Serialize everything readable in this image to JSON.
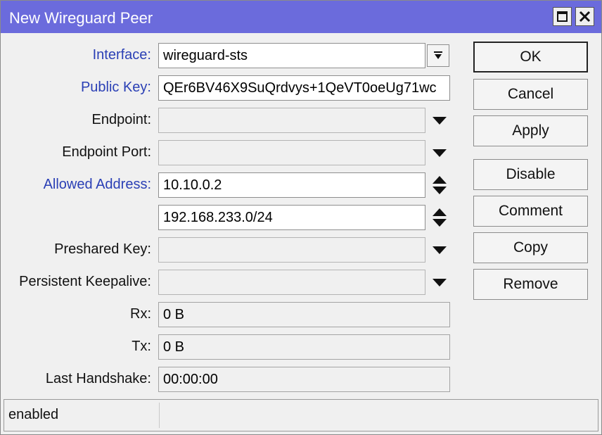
{
  "window": {
    "title": "New Wireguard Peer"
  },
  "form": {
    "interface": {
      "label": "Interface:",
      "value": "wireguard-sts"
    },
    "public_key": {
      "label": "Public Key:",
      "value": "QEr6BV46X9SuQrdvys+1QeVT0oeUg71wc"
    },
    "endpoint": {
      "label": "Endpoint:",
      "value": ""
    },
    "endpoint_port": {
      "label": "Endpoint Port:",
      "value": ""
    },
    "allowed_address": {
      "label": "Allowed Address:",
      "values": [
        "10.10.0.2",
        "192.168.233.0/24"
      ]
    },
    "preshared_key": {
      "label": "Preshared Key:",
      "value": ""
    },
    "persistent_keepalive": {
      "label": "Persistent Keepalive:",
      "value": ""
    },
    "rx": {
      "label": "Rx:",
      "value": "0 B"
    },
    "tx": {
      "label": "Tx:",
      "value": "0 B"
    },
    "last_handshake": {
      "label": "Last Handshake:",
      "value": "00:00:00"
    }
  },
  "buttons": {
    "ok": "OK",
    "cancel": "Cancel",
    "apply": "Apply",
    "disable": "Disable",
    "comment": "Comment",
    "copy": "Copy",
    "remove": "Remove"
  },
  "status": {
    "text": "enabled"
  },
  "colors": {
    "titlebar": "#6b6bdc",
    "label_accent": "#2a3fb5",
    "window_bg": "#f0f0f0"
  }
}
